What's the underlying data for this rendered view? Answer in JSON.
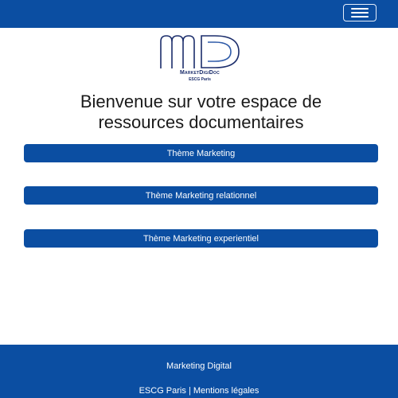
{
  "header": {
    "menu_icon": "hamburger-menu-icon"
  },
  "logo": {
    "name": "MarketDigiDoc",
    "subtitle": "ESCG Paris",
    "colors": {
      "primary": "#1b2d6b",
      "accent": "#2e5aa8"
    }
  },
  "welcome": {
    "line1": "Bienvenue sur votre espace de",
    "line2": "ressources documentaires"
  },
  "themes": [
    {
      "label": "Thème Marketing"
    },
    {
      "label": "Thème Marketing relationnel"
    },
    {
      "label": "Thème Marketing experientiel"
    }
  ],
  "footer": {
    "title": "Marketing Digital",
    "link1": "ESCG Paris",
    "separator": "|",
    "link2": "Mentions légales"
  },
  "colors": {
    "brand_blue": "#0b4ea2",
    "text": "#1a1a1a",
    "background": "#ffffff"
  }
}
